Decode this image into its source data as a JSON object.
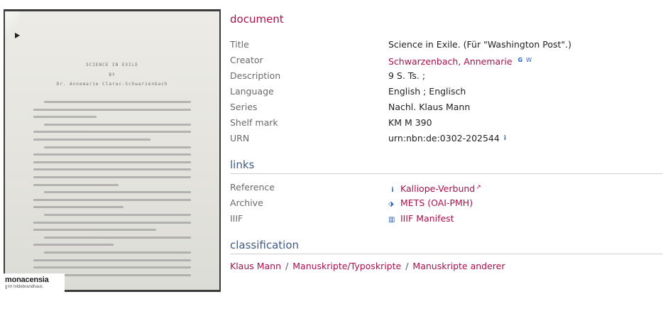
{
  "thumbnail": {
    "heading_line1": "SCIENCE IN EXILE",
    "heading_line2": "BY",
    "heading_line3": "Dr. Annemarie Clarac-Schwarzenbach",
    "logo_text": "monacensia",
    "logo_sub": "im hildebrandhaus"
  },
  "document": {
    "heading": "document",
    "fields": [
      {
        "label": "Title",
        "value": "Science in Exile. (Für \"Washington Post\".)"
      },
      {
        "label": "Creator",
        "value_a": "Schwarzenbach",
        "value_sep": ", ",
        "value_b": "Annemarie",
        "badge_g": "G",
        "badge_w": "W"
      },
      {
        "label": "Description",
        "value": "9 S. Ts. ;"
      },
      {
        "label": "Language",
        "value": "English ; Englisch"
      },
      {
        "label": "Series",
        "value": "Nachl. Klaus Mann"
      },
      {
        "label": "Shelf mark",
        "value": "KM M 390"
      },
      {
        "label": "URN",
        "value": "urn:nbn:de:0302-202544",
        "info_icon": "i"
      }
    ]
  },
  "links": {
    "heading": "links",
    "items": [
      {
        "label": "Reference",
        "icon": "info-icon",
        "glyph": "i",
        "text": "Kalliope-Verbund",
        "ext": "↗"
      },
      {
        "label": "Archive",
        "icon": "tag-icon",
        "glyph": "⬗",
        "text": "METS (OAI-PMH)"
      },
      {
        "label": "IIIF",
        "icon": "iiif-icon",
        "glyph": "▥",
        "text": "IIIF Manifest"
      }
    ]
  },
  "classification": {
    "heading": "classification",
    "crumbs": [
      "Klaus Mann",
      "Manuskripte/Typoskripte",
      "Manuskripte anderer"
    ],
    "separator": "/"
  },
  "colors": {
    "accent": "#a8104a",
    "section_blue": "#3f5a85",
    "icon_blue": "#1f5fbf"
  }
}
